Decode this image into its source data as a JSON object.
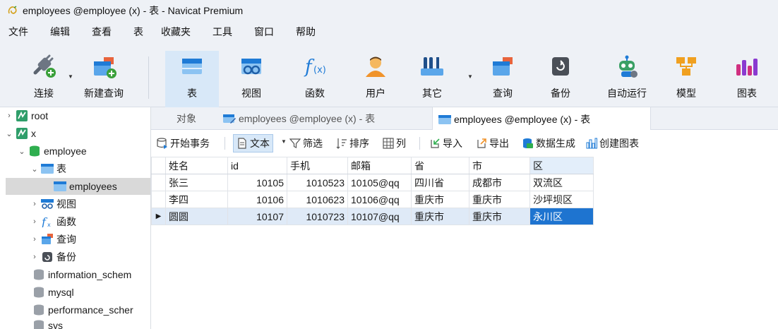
{
  "window": {
    "title": "employees @employee (x) - 表 - Navicat Premium",
    "accent_color": "#1e74d0"
  },
  "menu": [
    "文件",
    "编辑",
    "查看",
    "表",
    "收藏夹",
    "工具",
    "窗口",
    "帮助"
  ],
  "ribbon": {
    "connect": "连接",
    "new_query": "新建查询",
    "table": "表",
    "view": "视图",
    "function": "函数",
    "user": "用户",
    "other": "其它",
    "query": "查询",
    "backup": "备份",
    "automation": "自动运行",
    "model": "模型",
    "chart": "图表",
    "active": "表"
  },
  "sidebar": {
    "root": "root",
    "x": "x",
    "db": "employee",
    "tables_group": "表",
    "table_employees": "employees",
    "views": "视图",
    "functions": "函数",
    "queries": "查询",
    "backups": "备份",
    "db2": "information_schem",
    "db3": "mysql",
    "db4": "performance_scher",
    "db5": "sys"
  },
  "tabs": {
    "objects": "对象",
    "tab1": "employees @employee (x) - 表",
    "tab2": "employees @employee (x) - 表"
  },
  "toolbar": {
    "begin_tx": "开始事务",
    "text": "文本",
    "filter": "筛选",
    "sort": "排序",
    "columns": "列",
    "import": "导入",
    "export": "导出",
    "data_gen": "数据生成",
    "create_chart": "创建图表"
  },
  "grid": {
    "columns": [
      "姓名",
      "id",
      "手机",
      "邮箱",
      "省",
      "市",
      "区"
    ],
    "rows": [
      [
        "张三",
        "10105",
        "1010523",
        "10105@qq",
        "四川省",
        "成都市",
        "双流区"
      ],
      [
        "李四",
        "10106",
        "1010623",
        "10106@qq",
        "重庆市",
        "重庆市",
        "沙坪坝区"
      ],
      [
        "圆圆",
        "10107",
        "1010723",
        "10107@qq",
        "重庆市",
        "重庆市",
        "永川区"
      ]
    ],
    "current_row_marker": "▶"
  }
}
